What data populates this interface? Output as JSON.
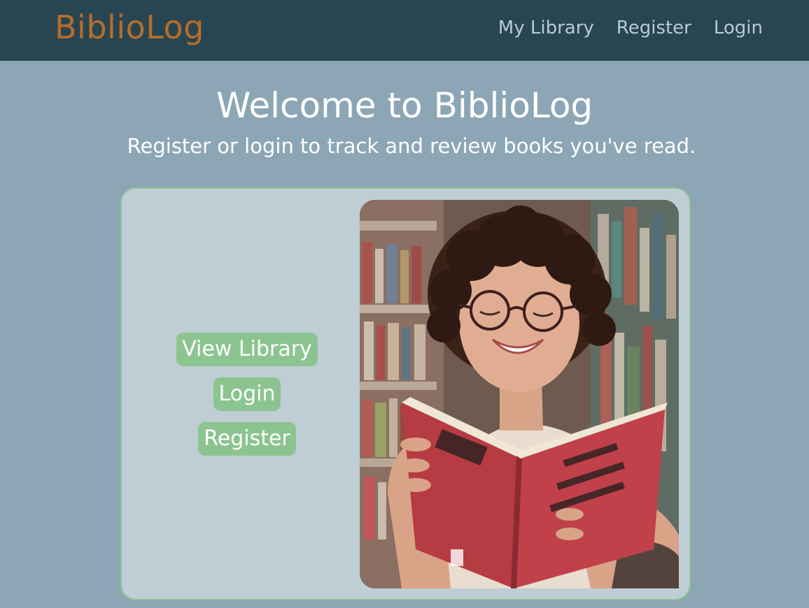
{
  "navbar": {
    "brand": "BiblioLog",
    "links": [
      {
        "label": "My Library"
      },
      {
        "label": "Register"
      },
      {
        "label": "Login"
      }
    ]
  },
  "hero": {
    "title": "Welcome to BiblioLog",
    "subtitle": "Register or login to track and review books you've read."
  },
  "card": {
    "buttons": [
      {
        "label": "View Library"
      },
      {
        "label": "Login"
      },
      {
        "label": "Register"
      }
    ],
    "photo_icon": "reader-photo"
  },
  "colors": {
    "navbar_bg": "#284552",
    "brand": "#b66d2a",
    "page_bg": "#8ca6b5",
    "card_bg": "#bfcdd4",
    "accent_green": "#8cc48f"
  }
}
